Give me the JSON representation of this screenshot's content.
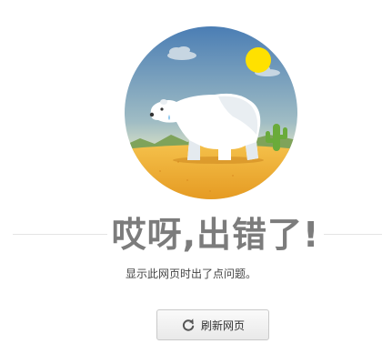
{
  "error_page": {
    "illustration": {
      "icon": "polar-bear-desert-illustration",
      "colors": {
        "sky_top": "#4f7fb3",
        "sky_bottom": "#c8d8d0",
        "sand": "#f2b83c",
        "sun": "#ffe100",
        "bear": "#ffffff",
        "cactus": "#6fae3a",
        "hills": "#7a9f4e"
      }
    },
    "headline": "哎呀,出错了!",
    "message": "显示此网页时出了点问题。",
    "refresh_button": {
      "label": "刷新网页",
      "icon": "refresh-icon"
    },
    "colors": {
      "headline_text": "#7c7c7c",
      "divider": "#e4e4e4",
      "button_border": "#c9c9c9"
    }
  }
}
